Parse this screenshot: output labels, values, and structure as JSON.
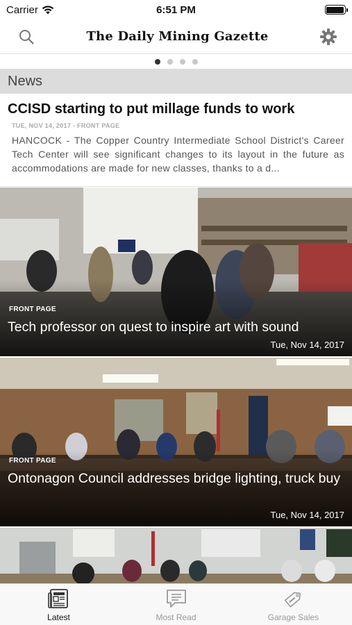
{
  "status_bar": {
    "carrier": "Carrier",
    "time": "6:51 PM"
  },
  "nav": {
    "title": "The Daily Mining Gazette",
    "search_icon": "search-icon",
    "settings_icon": "gear-icon"
  },
  "pager": {
    "count": 4,
    "active": 0
  },
  "section": {
    "title": "News"
  },
  "lead_article": {
    "headline": "CCISD starting to put millage funds to work",
    "meta": "Tue, Nov 14, 2017 - FRONT PAGE",
    "excerpt": "HANCOCK - The Copper Country Intermediate School District's Career Tech Center will see significant changes to its layout in the future as accommodations are made for new classes, thanks to a d..."
  },
  "image_articles": [
    {
      "section": "FRONT PAGE",
      "headline": "Tech professor on quest to inspire art with sound",
      "date": "Tue, Nov 14, 2017"
    },
    {
      "section": "FRONT PAGE",
      "headline": "Ontonagon Council  addresses bridge lighting, truck buy",
      "date": "Tue, Nov 14, 2017"
    }
  ],
  "tabs": [
    {
      "label": "Latest",
      "icon": "newspaper-icon",
      "active": true
    },
    {
      "label": "Most Read",
      "icon": "chat-bubble-icon",
      "active": false
    },
    {
      "label": "Garage Sales",
      "icon": "sale-tag-icon",
      "active": false
    }
  ],
  "colors": {
    "section_bg": "#dcdcdc",
    "active_dot": "#333333",
    "tab_active": "#111111",
    "tab_inactive": "#999999"
  }
}
